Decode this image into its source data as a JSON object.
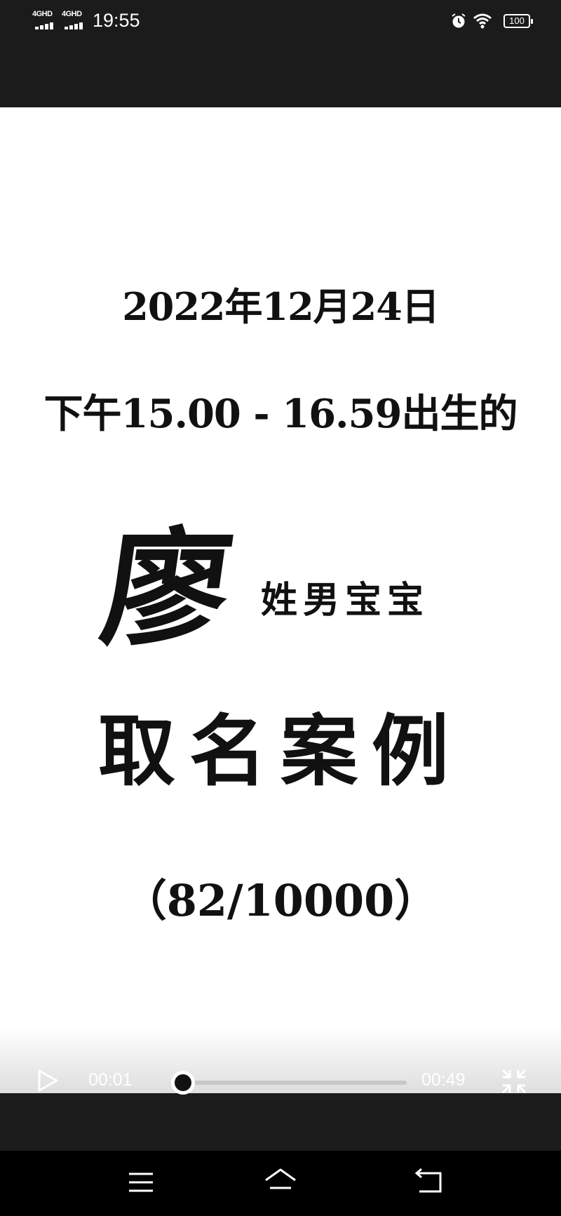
{
  "status_bar": {
    "network_1": "4GHD",
    "network_2": "4GHD",
    "time": "19:55",
    "battery": "100",
    "icons": [
      "alarm-icon",
      "wifi-icon",
      "battery-icon"
    ]
  },
  "content": {
    "date_line": "2022年12月24日",
    "time_line": "下午15.00 - 16.59出生的",
    "surname": "廖",
    "gender_line": "姓男宝宝",
    "heading": "取名案例",
    "count_line": "（82/10000）"
  },
  "player": {
    "current_time": "00:01",
    "duration": "00:49",
    "progress": 0.02,
    "icons": [
      "play-icon",
      "exit-fullscreen-icon"
    ]
  },
  "nav_bar": {
    "icons": [
      "menu-icon",
      "home-icon",
      "back-icon"
    ]
  },
  "colors": {
    "bar_background": "#1b1b1b",
    "content_background": "#ffffff",
    "text": "#111111"
  }
}
